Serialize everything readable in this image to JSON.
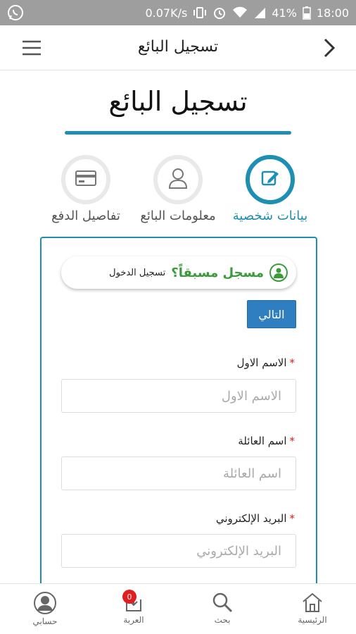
{
  "status_bar": {
    "speed": "0.07K/s",
    "battery": "41%",
    "time": "18:00",
    "icons": [
      "whatsapp-icon",
      "vibrate-icon",
      "alarm-icon",
      "wifi-icon",
      "signal-icon",
      "battery-icon"
    ]
  },
  "app_bar": {
    "title": "تسجيل البائع",
    "icons": {
      "back": "chevron-right-icon",
      "menu": "hamburger-menu-icon"
    }
  },
  "page": {
    "heading": "تسجيل البائع",
    "accent_color": "#1e8eb3"
  },
  "steps": [
    {
      "label": "بيانات شخصية",
      "icon": "edit-icon",
      "active": true
    },
    {
      "label": "معلومات البائع",
      "icon": "user-outline-icon",
      "active": false
    },
    {
      "label": "تفاصيل الدفع",
      "icon": "credit-card-icon",
      "active": false
    }
  ],
  "form": {
    "already_registered": "مسجل مسبقاً؟",
    "login_link": "تسجيل الدخول",
    "next_button": "التالي",
    "fields": [
      {
        "label": "الاسم الاول",
        "placeholder": "الاسم الاول",
        "required": "*"
      },
      {
        "label": "اسم العائلة",
        "placeholder": "اسم العائلة",
        "required": "*"
      },
      {
        "label": "البريد الإلكتروني",
        "placeholder": "البريد الإلكتروني",
        "required": "*"
      }
    ]
  },
  "bottom_nav": [
    {
      "label": "الرئيسية",
      "icon": "home-icon"
    },
    {
      "label": "بحث",
      "icon": "search-icon"
    },
    {
      "label": "العربة",
      "icon": "cart-icon",
      "badge": "0"
    },
    {
      "label": "حسابي",
      "icon": "account-icon"
    }
  ]
}
